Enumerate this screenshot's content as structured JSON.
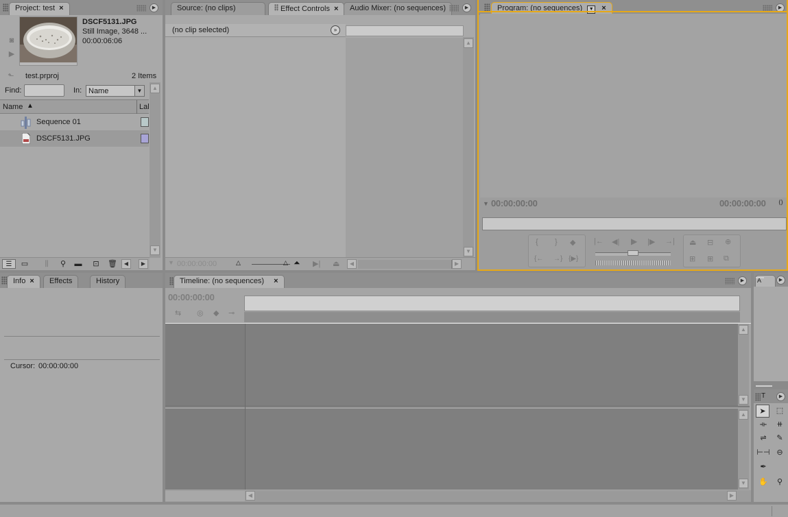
{
  "project": {
    "tab_label": "Project: test",
    "clip_name": "DSCF5131.JPG",
    "clip_type": "Still Image, 3648 ...",
    "clip_duration": "00:00:06:06",
    "project_file": "test.prproj",
    "item_count": "2 Items",
    "find_label": "Find:",
    "find_value": "",
    "in_label": "In:",
    "in_value": "Name",
    "col_name": "Name",
    "col_label": "Lal",
    "items": [
      {
        "name": "Sequence 01",
        "label_color": "#b9c9c9"
      },
      {
        "name": "DSCF5131.JPG",
        "label_color": "#a8a4d6"
      }
    ]
  },
  "source_tabs": {
    "source": "Source: (no clips)",
    "effect_controls": "Effect Controls",
    "audio_mixer": "Audio Mixer: (no sequences)"
  },
  "effect_controls": {
    "no_clip": "(no clip selected)",
    "timecode": "00:00:00:00"
  },
  "program": {
    "tab_label": "Program: (no sequences)",
    "time_left": "00:00:00:00",
    "time_right": "00:00:00:00",
    "accent_color": "#e6a817"
  },
  "info_tabs": {
    "info": "Info",
    "effects": "Effects",
    "history": "History"
  },
  "info": {
    "cursor_label": "Cursor:",
    "cursor_value": "00:00:00:00"
  },
  "timeline": {
    "tab_label": "Timeline: (no sequences)",
    "timecode": "00:00:00:00"
  },
  "tools": {
    "panel_label": "T"
  }
}
